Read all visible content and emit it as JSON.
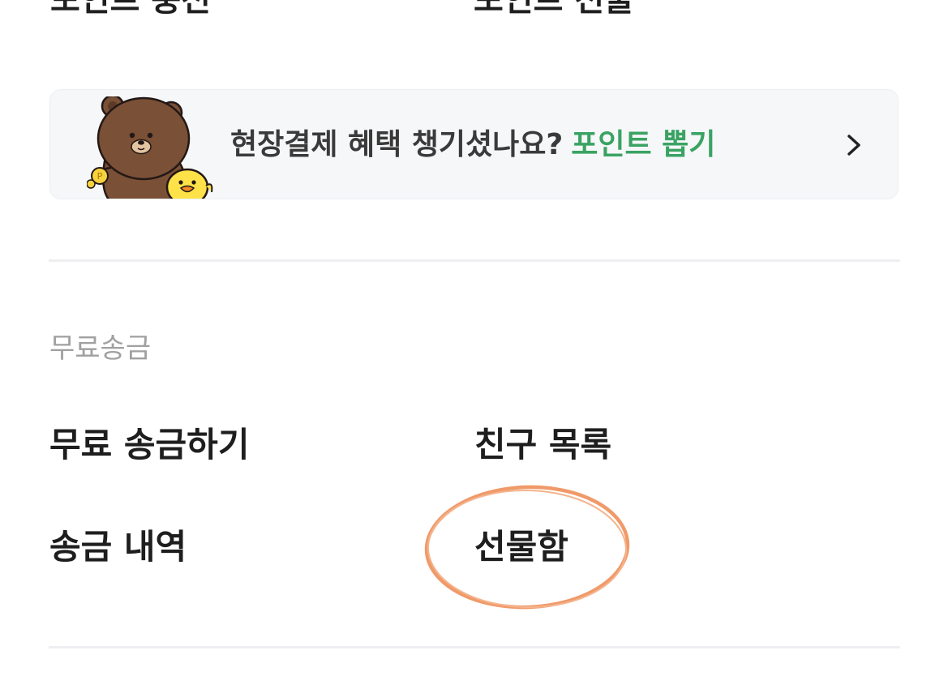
{
  "top_row": {
    "left_label": "포인트 충전",
    "right_label": "포인트 선물"
  },
  "banner": {
    "text": "현장결제 혜택 챙기셨나요?",
    "highlight": "포인트 뽑기",
    "highlight_color": "#3aa363",
    "illustration": "brown-bear-and-sally-chick-icon",
    "chevron": "chevron-right-icon"
  },
  "free_transfer": {
    "title": "무료송금",
    "items": [
      {
        "label": "무료 송금하기"
      },
      {
        "label": "친구 목록"
      },
      {
        "label": "송금 내역"
      },
      {
        "label": "선물함"
      }
    ]
  },
  "annotation": {
    "circled_item": "선물함",
    "circle_color": "#f09a6a"
  }
}
